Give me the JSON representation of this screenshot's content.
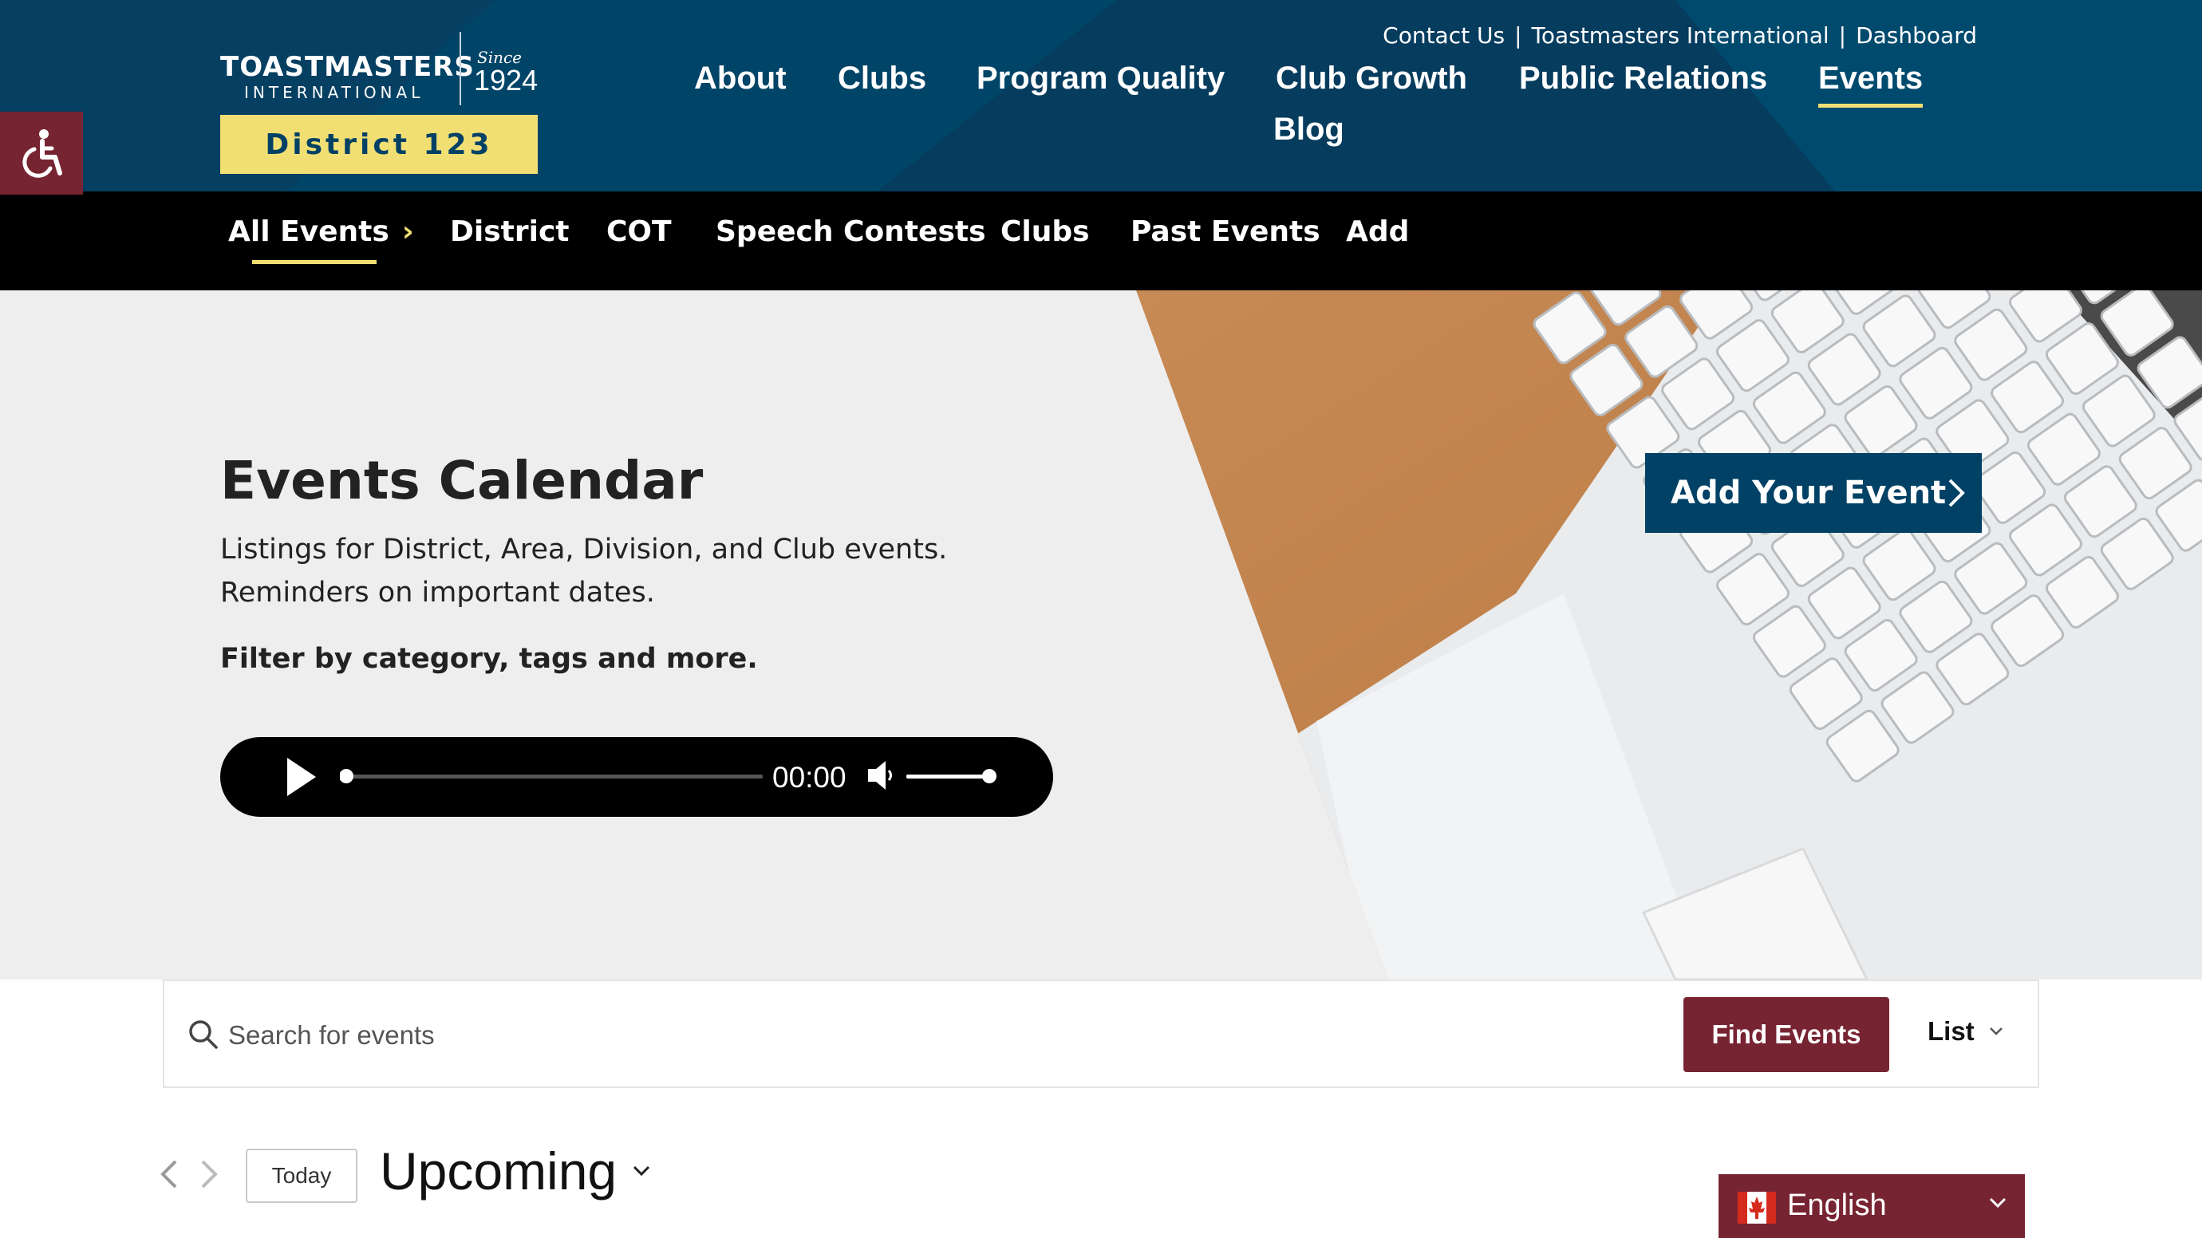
{
  "header": {
    "logo_main": "TOASTMASTERS",
    "logo_sub": "INTERNATIONAL",
    "logo_since": "Since",
    "logo_year": "1924",
    "district_badge": "District 123",
    "utility_links": [
      "Contact Us",
      "Toastmasters International",
      "Dashboard"
    ],
    "utility_separator": "|",
    "nav": [
      {
        "label": "About"
      },
      {
        "label": "Clubs"
      },
      {
        "label": "Program Quality"
      },
      {
        "label": "Club Growth"
      },
      {
        "label": "Public Relations"
      },
      {
        "label": "Events",
        "active": true
      },
      {
        "label": "Blog"
      }
    ],
    "accessibility_icon": "wheelchair-icon"
  },
  "sub_nav": {
    "items": [
      {
        "label": "All Events",
        "active": true
      },
      {
        "label": "District"
      },
      {
        "label": "COT"
      },
      {
        "label": "Speech Contests"
      },
      {
        "label": "Clubs"
      },
      {
        "label": "Past Events"
      },
      {
        "label": "Add"
      }
    ],
    "active_chevron": "›"
  },
  "hero": {
    "title": "Events Calendar",
    "description_line1": "Listings for District, Area, Division, and Club events.",
    "description_line2": "Reminders on important dates.",
    "filter_text": "Filter by category, tags and more.",
    "audio_time": "00:00",
    "add_event_label": "Add Your Event"
  },
  "search": {
    "placeholder": "Search for events",
    "find_button": "Find Events",
    "view_label": "List"
  },
  "calendar_nav": {
    "today_label": "Today",
    "period_label": "Upcoming"
  },
  "language": {
    "label": "English",
    "flag": "canada-flag-icon"
  },
  "colors": {
    "brand_blue": "#004165",
    "brand_maroon": "#772432",
    "brand_yellow": "#f2df74",
    "subnav_black": "#000000"
  }
}
